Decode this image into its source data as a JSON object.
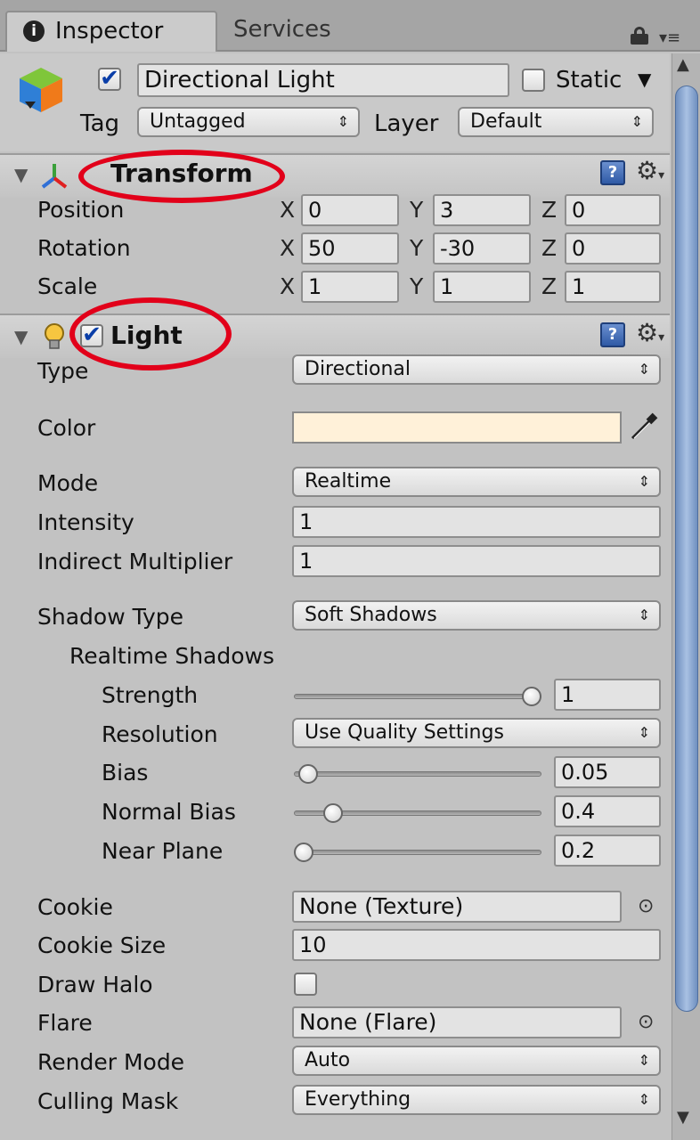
{
  "tabs": {
    "inspector": "Inspector",
    "services": "Services"
  },
  "header": {
    "active": true,
    "name": "Directional Light",
    "static_label": "Static",
    "static_checked": false,
    "tag_label": "Tag",
    "tag_value": "Untagged",
    "layer_label": "Layer",
    "layer_value": "Default"
  },
  "transform": {
    "title": "Transform",
    "rows": [
      {
        "label": "Position",
        "x": "0",
        "y": "3",
        "z": "0"
      },
      {
        "label": "Rotation",
        "x": "50",
        "y": "-30",
        "z": "0"
      },
      {
        "label": "Scale",
        "x": "1",
        "y": "1",
        "z": "1"
      }
    ],
    "axes": {
      "x": "X",
      "y": "Y",
      "z": "Z"
    }
  },
  "light": {
    "title": "Light",
    "enabled": true,
    "type_label": "Type",
    "type_value": "Directional",
    "color_label": "Color",
    "color_value": "#fff1d9",
    "mode_label": "Mode",
    "mode_value": "Realtime",
    "intensity_label": "Intensity",
    "intensity_value": "1",
    "indirect_label": "Indirect Multiplier",
    "indirect_value": "1",
    "shadow_type_label": "Shadow Type",
    "shadow_type_value": "Soft Shadows",
    "realtime_shadows_label": "Realtime Shadows",
    "strength_label": "Strength",
    "strength_value": "1",
    "strength_fraction": 1.0,
    "resolution_label": "Resolution",
    "resolution_value": "Use Quality Settings",
    "bias_label": "Bias",
    "bias_value": "0.05",
    "bias_fraction": 0.02,
    "normal_bias_label": "Normal Bias",
    "normal_bias_value": "0.4",
    "normal_bias_fraction": 0.13,
    "near_plane_label": "Near Plane",
    "near_plane_value": "0.2",
    "near_plane_fraction": 0.0,
    "cookie_label": "Cookie",
    "cookie_value": "None (Texture)",
    "cookie_size_label": "Cookie Size",
    "cookie_size_value": "10",
    "draw_halo_label": "Draw Halo",
    "draw_halo_checked": false,
    "flare_label": "Flare",
    "flare_value": "None (Flare)",
    "render_mode_label": "Render Mode",
    "render_mode_value": "Auto",
    "culling_mask_label": "Culling Mask",
    "culling_mask_value": "Everything"
  },
  "icons": {
    "info": "info-icon",
    "lock": "lock-icon",
    "menu": "menu-icon",
    "cube": "gameobject-cube-icon",
    "transform": "transform-axes-icon",
    "light": "light-bulb-icon",
    "help": "help-book-icon",
    "gear": "gear-icon",
    "picker": "eyedropper-icon",
    "object_picker": "object-picker-icon"
  },
  "colors": {
    "annotation": "#e2001a",
    "panel": "#c2c2c2",
    "help_blue": "#3a63ad"
  }
}
